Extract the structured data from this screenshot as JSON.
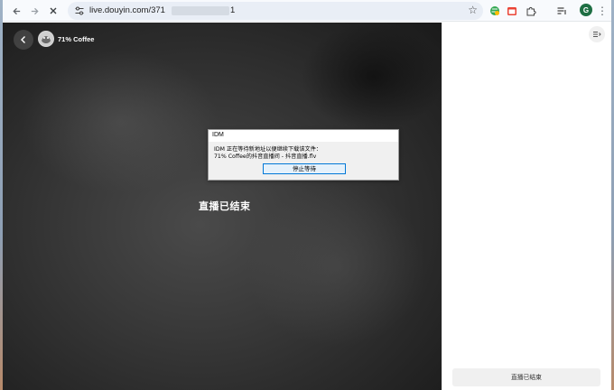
{
  "browser": {
    "url_visible": "live.douyin.com/371",
    "url_tail": "1",
    "avatar_letter": "G"
  },
  "stream": {
    "streamer_name": "71% Coffee",
    "status_text": "直播已结束"
  },
  "idm_dialog": {
    "title": "IDM",
    "message_line1": "IDM 正在等待新地址以便继续下载该文件：",
    "message_line2": "71% Coffee的抖音直播间 - 抖音直播.flv",
    "button_label": "停止等待"
  },
  "sidebar": {
    "ended_bar_label": "直播已结束"
  },
  "colors": {
    "toolbar_bg": "#f8fafd",
    "omnibox_bg": "#e9eef6",
    "dialog_button_border": "#0078d7",
    "avatar_bg": "#1e6e43"
  }
}
